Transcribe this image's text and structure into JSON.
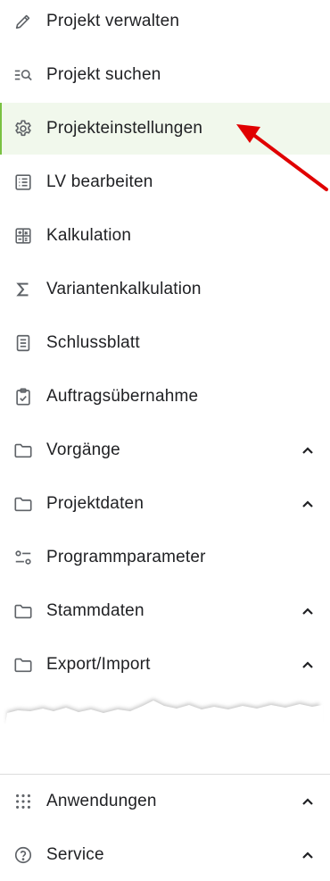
{
  "menu": {
    "items": [
      {
        "label": "Projekt verwalten",
        "icon": "pencil-icon"
      },
      {
        "label": "Projekt suchen",
        "icon": "list-search-icon"
      },
      {
        "label": "Projekteinstellungen",
        "icon": "gear-icon",
        "active": true
      },
      {
        "label": "LV bearbeiten",
        "icon": "list-document-icon"
      },
      {
        "label": "Kalkulation",
        "icon": "calculator-icon"
      },
      {
        "label": "Variantenkalkulation",
        "icon": "sigma-icon"
      },
      {
        "label": "Schlussblatt",
        "icon": "document-icon"
      },
      {
        "label": "Auftragsübernahme",
        "icon": "clipboard-check-icon"
      },
      {
        "label": "Vorgänge",
        "icon": "folder-icon",
        "expandable": true
      },
      {
        "label": "Projektdaten",
        "icon": "folder-icon",
        "expandable": true
      },
      {
        "label": "Programmparameter",
        "icon": "sliders-icon"
      },
      {
        "label": "Stammdaten",
        "icon": "folder-icon",
        "expandable": true
      },
      {
        "label": "Export/Import",
        "icon": "folder-icon",
        "expandable": true
      }
    ],
    "bottom_items": [
      {
        "label": "Anwendungen",
        "icon": "apps-grid-icon",
        "expandable": true
      },
      {
        "label": "Service",
        "icon": "help-circle-icon",
        "expandable": true
      }
    ]
  },
  "colors": {
    "active_background": "#f1f8ec",
    "active_border": "#7ac142",
    "annotation_arrow": "#e00000"
  }
}
